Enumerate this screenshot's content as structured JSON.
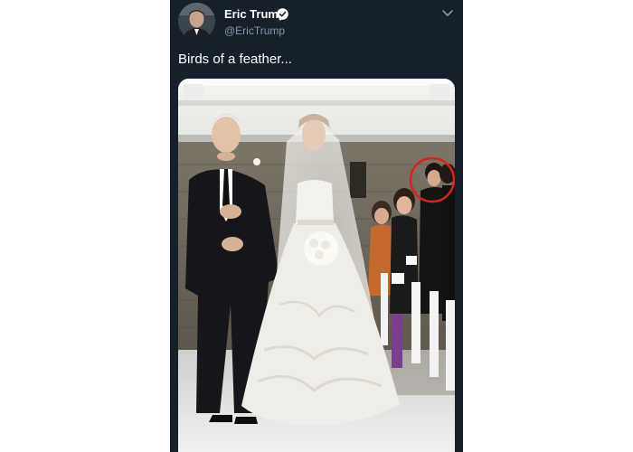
{
  "tweet": {
    "author": {
      "display_name": "Eric Trump",
      "handle": "@EricTrump",
      "verified": true,
      "avatar_icon": "profile-photo"
    },
    "text": "Birds of a feather...",
    "media": {
      "type": "photo",
      "highlight_color": "#d9221c"
    },
    "menu_icon": "chevron-down-icon"
  },
  "theme": {
    "background": "#15202b",
    "primary_text": "#ffffff",
    "secondary_text": "#8899a6"
  }
}
